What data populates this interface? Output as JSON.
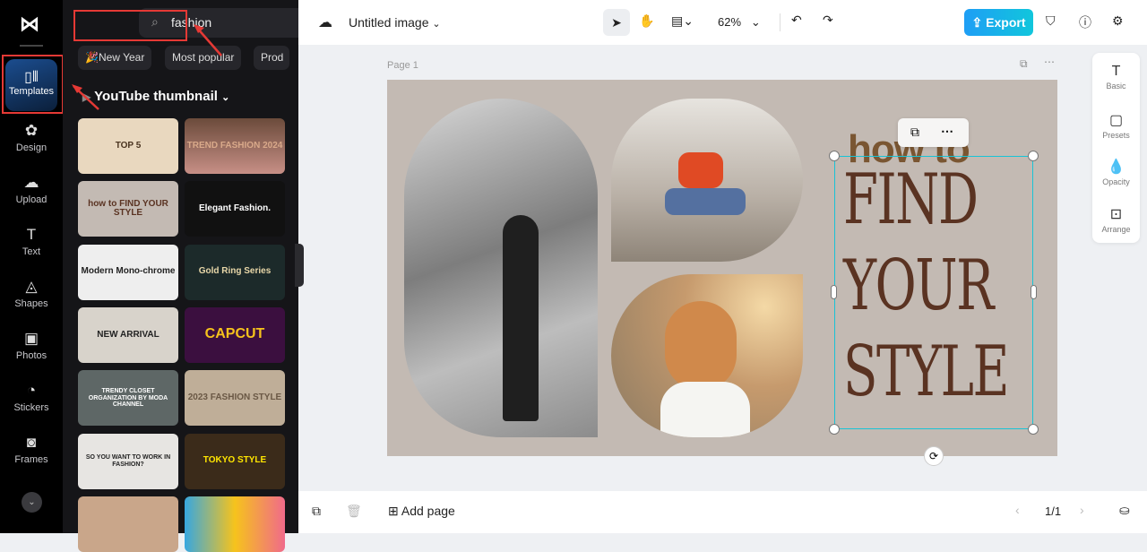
{
  "sidebar": {
    "items": [
      {
        "label": "Templates",
        "icon": "templates-icon"
      },
      {
        "label": "Design",
        "icon": "design-icon"
      },
      {
        "label": "Upload",
        "icon": "upload-icon"
      },
      {
        "label": "Text",
        "icon": "text-icon"
      },
      {
        "label": "Shapes",
        "icon": "shapes-icon"
      },
      {
        "label": "Photos",
        "icon": "photos-icon"
      },
      {
        "label": "Stickers",
        "icon": "stickers-icon"
      },
      {
        "label": "Frames",
        "icon": "frames-icon"
      }
    ]
  },
  "panel": {
    "search_value": "fashion",
    "chips": [
      "🎉New Year",
      "Most popular",
      "Prod"
    ],
    "category": "YouTube thumbnail",
    "templates": [
      "TOP 5",
      "TREND FASHION 2024",
      "how to FIND YOUR STYLE",
      "Elegant Fashion.",
      "Modern Mono-chrome",
      "Gold Ring Series",
      "NEW ARRIVAL",
      "CAPCUT",
      "TRENDY CLOSET ORGANIZATION BY MODA CHANNEL",
      "2023 FASHION STYLE",
      "SO YOU WANT TO WORK IN FASHION?",
      "TOKYO STYLE",
      "",
      ""
    ]
  },
  "header": {
    "title": "Untitled image",
    "zoom": "62%",
    "export": "Export"
  },
  "canvas": {
    "page_label": "Page 1",
    "text_small": "how to",
    "text_lines": [
      "FIND",
      "YOUR",
      "STYLE"
    ]
  },
  "props": [
    "Basic",
    "Presets",
    "Opacity",
    "Arrange"
  ],
  "footer": {
    "add_page": "Add page",
    "page_count": "1/1"
  },
  "colors": {
    "accent": "#19c3d6",
    "export": "#1ea7f0",
    "text_brown": "#5a3322"
  }
}
